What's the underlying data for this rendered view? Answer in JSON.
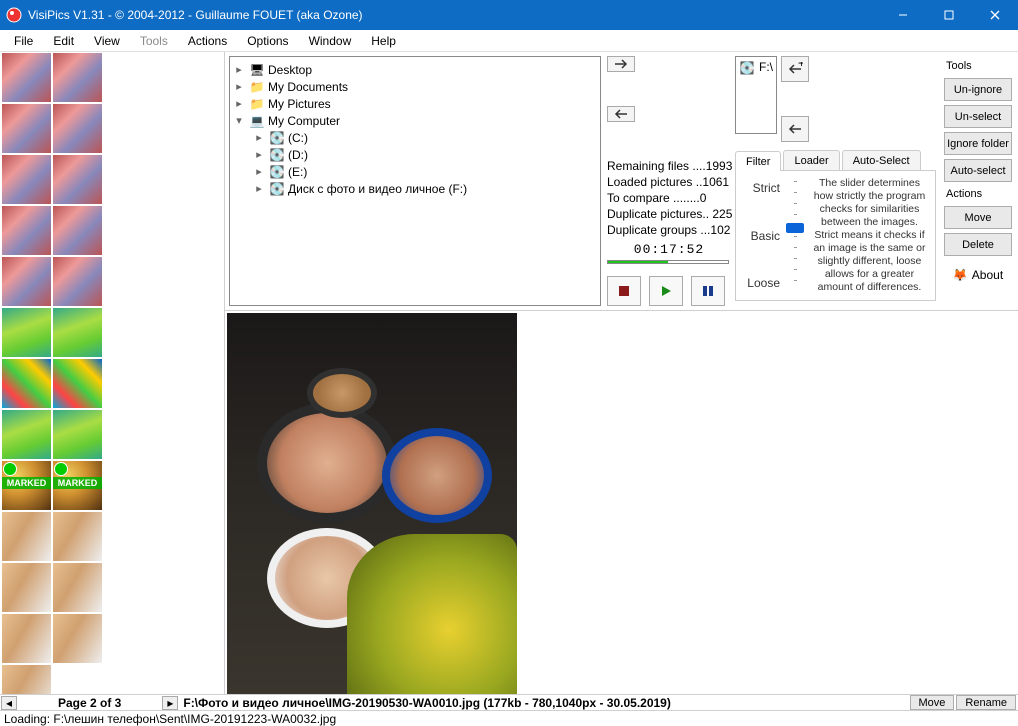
{
  "window": {
    "title": "VisiPics V1.31 - © 2004-2012 - Guillaume FOUET (aka Ozone)"
  },
  "menu": {
    "file": "File",
    "edit": "Edit",
    "view": "View",
    "tools": "Tools",
    "actions": "Actions",
    "options": "Options",
    "window": "Window",
    "help": "Help"
  },
  "tree": {
    "desktop": "Desktop",
    "mydocs": "My Documents",
    "mypics": "My Pictures",
    "mycomp": "My Computer",
    "c": "(C:)",
    "d": "(D:)",
    "e": "(E:)",
    "f": "Диск с фото и видео личное (F:)"
  },
  "path": {
    "selected": "F:\\"
  },
  "stats": {
    "remaining": "Remaining files ....1993",
    "loaded": "Loaded pictures ..1061",
    "compare": "To compare ........0",
    "duppics": "Duplicate pictures.. 225",
    "dupgrp": "Duplicate groups ...102",
    "time": "00:17:52"
  },
  "tabs": {
    "filter": "Filter",
    "loader": "Loader",
    "auto": "Auto-Select"
  },
  "slider": {
    "strict": "Strict",
    "basic": "Basic",
    "loose": "Loose",
    "desc": "The slider determines how strictly the program checks for similarities between the images. Strict means it checks if an image is the same or slightly different, loose allows for a greater amount of differences."
  },
  "side": {
    "tools": "Tools",
    "unignore": "Un-ignore",
    "unselect": "Un-select",
    "ignorefolder": "Ignore folder",
    "autoselect": "Auto-select",
    "actions": "Actions",
    "move": "Move",
    "delete": "Delete",
    "about": "About"
  },
  "pager": {
    "label": "Page 2 of 3",
    "info": "F:\\Фото и видео личное\\IMG-20190530-WA0010.jpg (177kb - 780,1040px - 30.05.2019)",
    "move": "Move",
    "rename": "Rename"
  },
  "status": {
    "text": "Loading: F:\\лешин телефон\\Sent\\IMG-20191223-WA0032.jpg"
  }
}
